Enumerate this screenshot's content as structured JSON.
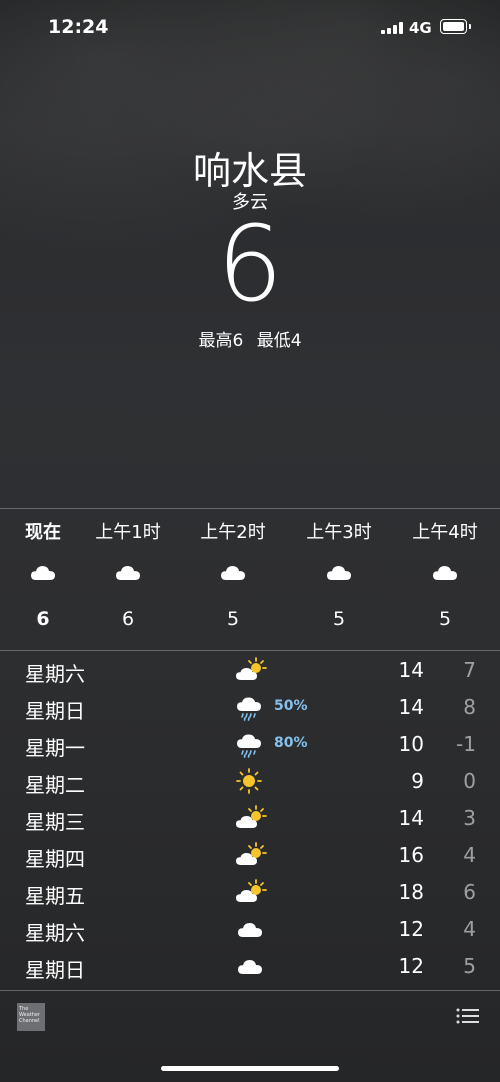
{
  "status_bar": {
    "time": "12:24",
    "network": "4G"
  },
  "location": {
    "city": "响水县",
    "condition": "多云",
    "temperature": "6",
    "high_label": "最高6",
    "low_label": "最低4"
  },
  "hourly": [
    {
      "label": "现在",
      "icon": "cloud-icon",
      "temp": "6"
    },
    {
      "label": "上午1时",
      "icon": "cloud-icon",
      "temp": "6"
    },
    {
      "label": "上午2时",
      "icon": "cloud-icon",
      "temp": "5"
    },
    {
      "label": "上午3时",
      "icon": "cloud-icon",
      "temp": "5"
    },
    {
      "label": "上午4时",
      "icon": "cloud-icon",
      "temp": "5"
    }
  ],
  "daily": [
    {
      "day": "星期六",
      "icon": "partly-sunny-icon",
      "precip": "",
      "high": "14",
      "low": "7"
    },
    {
      "day": "星期日",
      "icon": "rain-icon",
      "precip": "50%",
      "high": "14",
      "low": "8"
    },
    {
      "day": "星期一",
      "icon": "rain-icon",
      "precip": "80%",
      "high": "10",
      "low": "-1"
    },
    {
      "day": "星期二",
      "icon": "sun-icon",
      "precip": "",
      "high": "9",
      "low": "0"
    },
    {
      "day": "星期三",
      "icon": "partly-sunny-icon",
      "precip": "",
      "high": "14",
      "low": "3"
    },
    {
      "day": "星期四",
      "icon": "partly-sunny-icon",
      "precip": "",
      "high": "16",
      "low": "4"
    },
    {
      "day": "星期五",
      "icon": "partly-sunny-icon",
      "precip": "",
      "high": "18",
      "low": "6"
    },
    {
      "day": "星期六",
      "icon": "cloud-icon",
      "precip": "",
      "high": "12",
      "low": "4"
    },
    {
      "day": "星期日",
      "icon": "cloud-icon",
      "precip": "",
      "high": "12",
      "low": "5"
    }
  ],
  "footer": {
    "logo_text": "The Weather Channel"
  },
  "colors": {
    "precip": "#86c1ee",
    "sun": "#f7c52b"
  }
}
